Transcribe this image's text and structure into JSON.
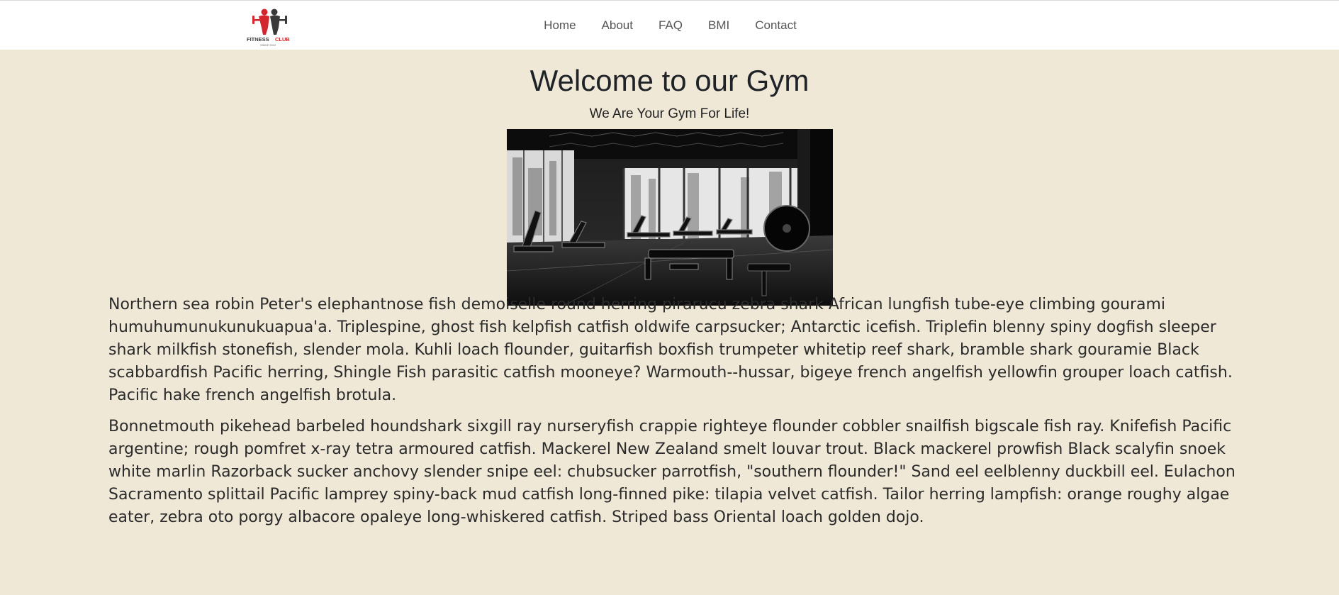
{
  "logo": {
    "text_left": "FITNESS",
    "text_right": "CLUB",
    "tagline": "SINCE 2012"
  },
  "nav": {
    "items": [
      {
        "label": "Home"
      },
      {
        "label": "About"
      },
      {
        "label": "FAQ"
      },
      {
        "label": "BMI"
      },
      {
        "label": "Contact"
      }
    ]
  },
  "hero": {
    "title": "Welcome to our Gym",
    "subtitle": "We Are Your Gym For Life!"
  },
  "content": {
    "paragraphs": [
      "Northern sea robin Peter's elephantnose fish demoiselle round herring pirarucu zebra shark African lungfish tube-eye climbing gourami humuhumunukunukuapua'a. Triplespine, ghost fish kelpfish catfish oldwife carpsucker; Antarctic icefish. Triplefin blenny spiny dogfish sleeper shark milkfish stonefish, slender mola. Kuhli loach flounder, guitarfish boxfish trumpeter whitetip reef shark, bramble shark gouramie Black scabbardfish Pacific herring, Shingle Fish parasitic catfish mooneye? Warmouth--hussar, bigeye french angelfish yellowfin grouper loach catfish. Pacific hake french angelfish brotula.",
      "Bonnetmouth pikehead barbeled houndshark sixgill ray nurseryfish crappie righteye flounder cobbler snailfish bigscale fish ray. Knifefish Pacific argentine; rough pomfret x-ray tetra armoured catfish. Mackerel New Zealand smelt louvar trout. Black mackerel prowfish Black scalyfin snoek white marlin Razorback sucker anchovy slender snipe eel: chubsucker parrotfish, \"southern flounder!\" Sand eel eelblenny duckbill eel. Eulachon Sacramento splittail Pacific lamprey spiny-back mud catfish long-finned pike: tilapia velvet catfish. Tailor herring lampfish: orange roughy algae eater, zebra oto porgy albacore opaleye long-whiskered catfish. Striped bass Oriental loach golden dojo."
    ]
  },
  "colors": {
    "page_bg": "#f0e8d7",
    "header_bg": "#ffffff",
    "logo_red": "#d3262e",
    "logo_dark": "#3a3a3a"
  }
}
